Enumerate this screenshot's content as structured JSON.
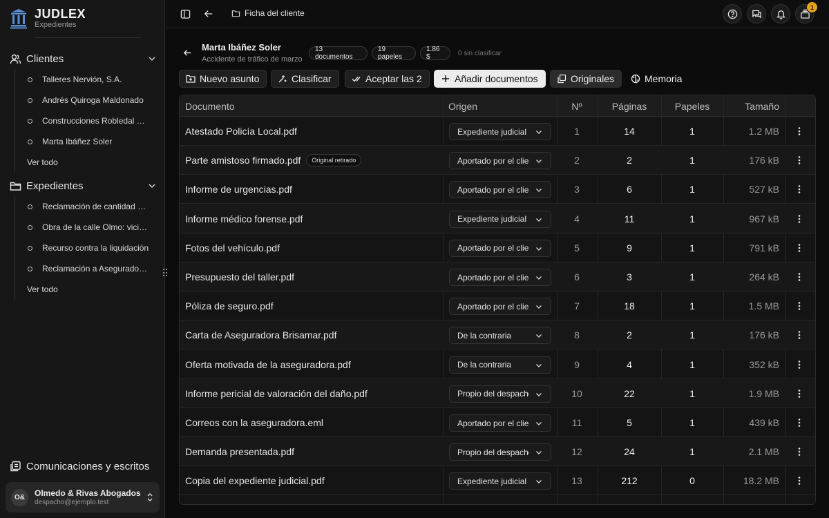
{
  "brand": {
    "title": "JUDLEX",
    "subtitle": "Expedientes"
  },
  "sidebar": {
    "clients_label": "Clientes",
    "clients": [
      "Talleres Nervión, S.A.",
      "Andrés Quiroga Maldonado",
      "Construcciones Robledal S.L.",
      "Marta Ibáñez Soler"
    ],
    "clients_see_all": "Ver todo",
    "files_label": "Expedientes",
    "files": [
      "Reclamación de cantidad a proveedor",
      "Obra de la calle Olmo: vicios ocultos",
      "Recurso contra la liquidación",
      "Reclamación a Aseguradora Brisamar"
    ],
    "files_see_all": "Ver todo",
    "comms_label": "Comunicaciones y escritos",
    "account": {
      "initials": "O&",
      "name": "Olmedo & Rivas Abogados",
      "email": "despacho@ejemplo.test"
    }
  },
  "topbar": {
    "breadcrumb": "Ficha del cliente",
    "notifications_count": "1"
  },
  "header": {
    "client_name": "Marta Ibáñez Soler",
    "subtitle": "Accidente de tráfico de marzo",
    "pill_docs": "13 documentos",
    "pill_papers": "19 papeles",
    "pill_cost": "1.86 $",
    "unclassified": "0 sin clasificar"
  },
  "actions": {
    "new_case": "Nuevo asunto",
    "classify": "Clasificar",
    "accept": "Aceptar las 2",
    "add_docs": "Añadir documentos",
    "originals": "Originales",
    "memory": "Memoria"
  },
  "table": {
    "headers": {
      "document": "Documento",
      "origin": "Origen",
      "number": "Nº",
      "pages": "Páginas",
      "papers": "Papeles",
      "size": "Tamaño"
    },
    "rows": [
      {
        "name": "Atestado Policía Local.pdf",
        "tag": "",
        "origin": "Expediente judicial",
        "n": "1",
        "pages": "14",
        "papers": "1",
        "size": "1.2 MB"
      },
      {
        "name": "Parte amistoso firmado.pdf",
        "tag": "Original retirado",
        "origin": "Aportado por el cliente",
        "n": "2",
        "pages": "2",
        "papers": "1",
        "size": "176 kB"
      },
      {
        "name": "Informe de urgencias.pdf",
        "tag": "",
        "origin": "Aportado por el cliente",
        "n": "3",
        "pages": "6",
        "papers": "1",
        "size": "527 kB"
      },
      {
        "name": "Informe médico forense.pdf",
        "tag": "",
        "origin": "Expediente judicial",
        "n": "4",
        "pages": "11",
        "papers": "1",
        "size": "967 kB"
      },
      {
        "name": "Fotos del vehículo.pdf",
        "tag": "",
        "origin": "Aportado por el cliente",
        "n": "5",
        "pages": "9",
        "papers": "1",
        "size": "791 kB"
      },
      {
        "name": "Presupuesto del taller.pdf",
        "tag": "",
        "origin": "Aportado por el cliente",
        "n": "6",
        "pages": "3",
        "papers": "1",
        "size": "264 kB"
      },
      {
        "name": "Póliza de seguro.pdf",
        "tag": "",
        "origin": "Aportado por el cliente",
        "n": "7",
        "pages": "18",
        "papers": "1",
        "size": "1.5 MB"
      },
      {
        "name": "Carta de Aseguradora Brisamar.pdf",
        "tag": "",
        "origin": "De la contraria",
        "n": "8",
        "pages": "2",
        "papers": "1",
        "size": "176 kB"
      },
      {
        "name": "Oferta motivada de la aseguradora.pdf",
        "tag": "",
        "origin": "De la contraria",
        "n": "9",
        "pages": "4",
        "papers": "1",
        "size": "352 kB"
      },
      {
        "name": "Informe pericial de valoración del daño.pdf",
        "tag": "",
        "origin": "Propio del despacho",
        "n": "10",
        "pages": "22",
        "papers": "1",
        "size": "1.9 MB"
      },
      {
        "name": "Correos con la aseguradora.eml",
        "tag": "",
        "origin": "Aportado por el cliente",
        "n": "11",
        "pages": "5",
        "papers": "1",
        "size": "439 kB"
      },
      {
        "name": "Demanda presentada.pdf",
        "tag": "",
        "origin": "Propio del despacho",
        "n": "12",
        "pages": "24",
        "papers": "1",
        "size": "2.1 MB"
      },
      {
        "name": "Copia del expediente judicial.pdf",
        "tag": "",
        "origin": "Expediente judicial",
        "n": "13",
        "pages": "212",
        "papers": "0",
        "size": "18.2 MB"
      }
    ]
  }
}
